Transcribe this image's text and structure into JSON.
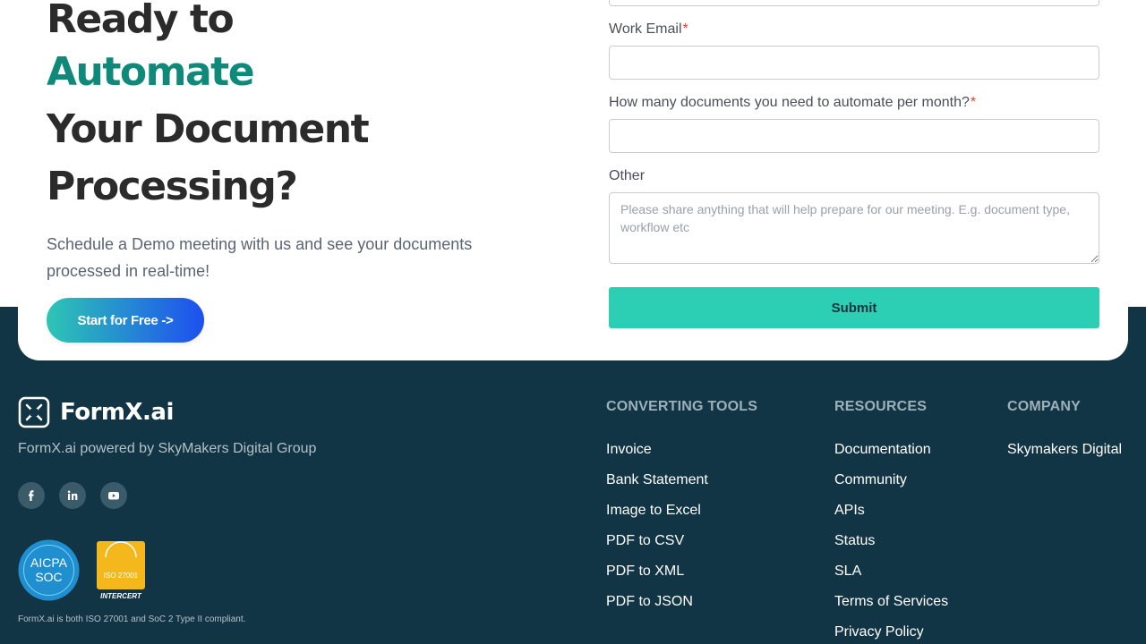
{
  "hero": {
    "line1": "Ready to",
    "line2": "Automate",
    "line3": "Your Document",
    "line4": "Processing?",
    "subtitle": "Schedule a Demo meeting with us and see your documents processed in real-time!",
    "cta_label": "Start for Free ->"
  },
  "form": {
    "work_email_label": "Work Email",
    "docs_label": "How many documents you need to automate per month?",
    "required_mark": "*",
    "other_label": "Other",
    "other_placeholder": "Please share anything that will help prepare for our meeting. E.g. document type, workflow etc",
    "submit_label": "Submit"
  },
  "footer": {
    "brand": "FormX.ai",
    "tagline": "FormX.ai powered by SkyMakers Digital Group",
    "social_icons": [
      "facebook-icon",
      "linkedin-icon",
      "youtube-icon"
    ],
    "badges": {
      "aicpa_line1": "AICPA",
      "aicpa_line2": "SOC",
      "iso_text": "ISO 27001",
      "iso_brand": "INTERCERT"
    },
    "compliance": "FormX.ai is both ISO 27001 and SoC 2 Type II compliant.",
    "columns": [
      {
        "heading": "CONVERTING TOOLS",
        "links": [
          "Invoice",
          "Bank Statement",
          "Image to Excel",
          "PDF to CSV",
          "PDF to XML",
          "PDF to JSON"
        ]
      },
      {
        "heading": "RESOURCES",
        "links": [
          "Documentation",
          "Community",
          "APIs",
          "Status",
          "SLA",
          "Terms of Services",
          "Privacy Policy"
        ]
      },
      {
        "heading": "COMPANY",
        "links": [
          "Skymakers Digital"
        ]
      }
    ]
  },
  "colors": {
    "accent_teal": "#0f8a7a",
    "submit_teal": "#2dcfb4",
    "footer_bg": "#123546",
    "cta_gradient_start": "#2ec6b4",
    "cta_gradient_end": "#1d4ff0"
  }
}
